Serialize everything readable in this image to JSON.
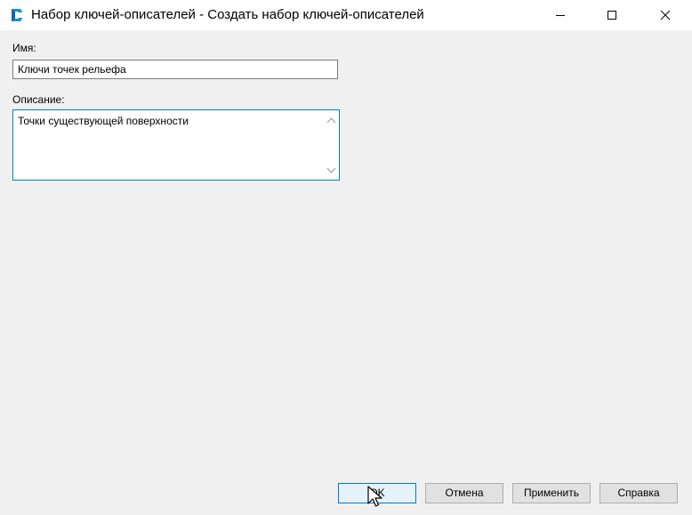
{
  "window": {
    "title": "Набор ключей-описателей - Создать набор ключей-описателей",
    "app_icon": "civil3d-c-icon",
    "controls": [
      "minimize-icon",
      "maximize-icon",
      "close-icon"
    ]
  },
  "form": {
    "name_label": "Имя:",
    "name_value": "Ключи точек рельефа",
    "description_label": "Описание:",
    "description_value": "Точки существующей поверхности"
  },
  "buttons": {
    "ok": "OK",
    "cancel": "Отмена",
    "apply": "Применить",
    "help": "Справка"
  },
  "colors": {
    "accent": "#0078d7",
    "app_icon": "#1e8fd6"
  }
}
